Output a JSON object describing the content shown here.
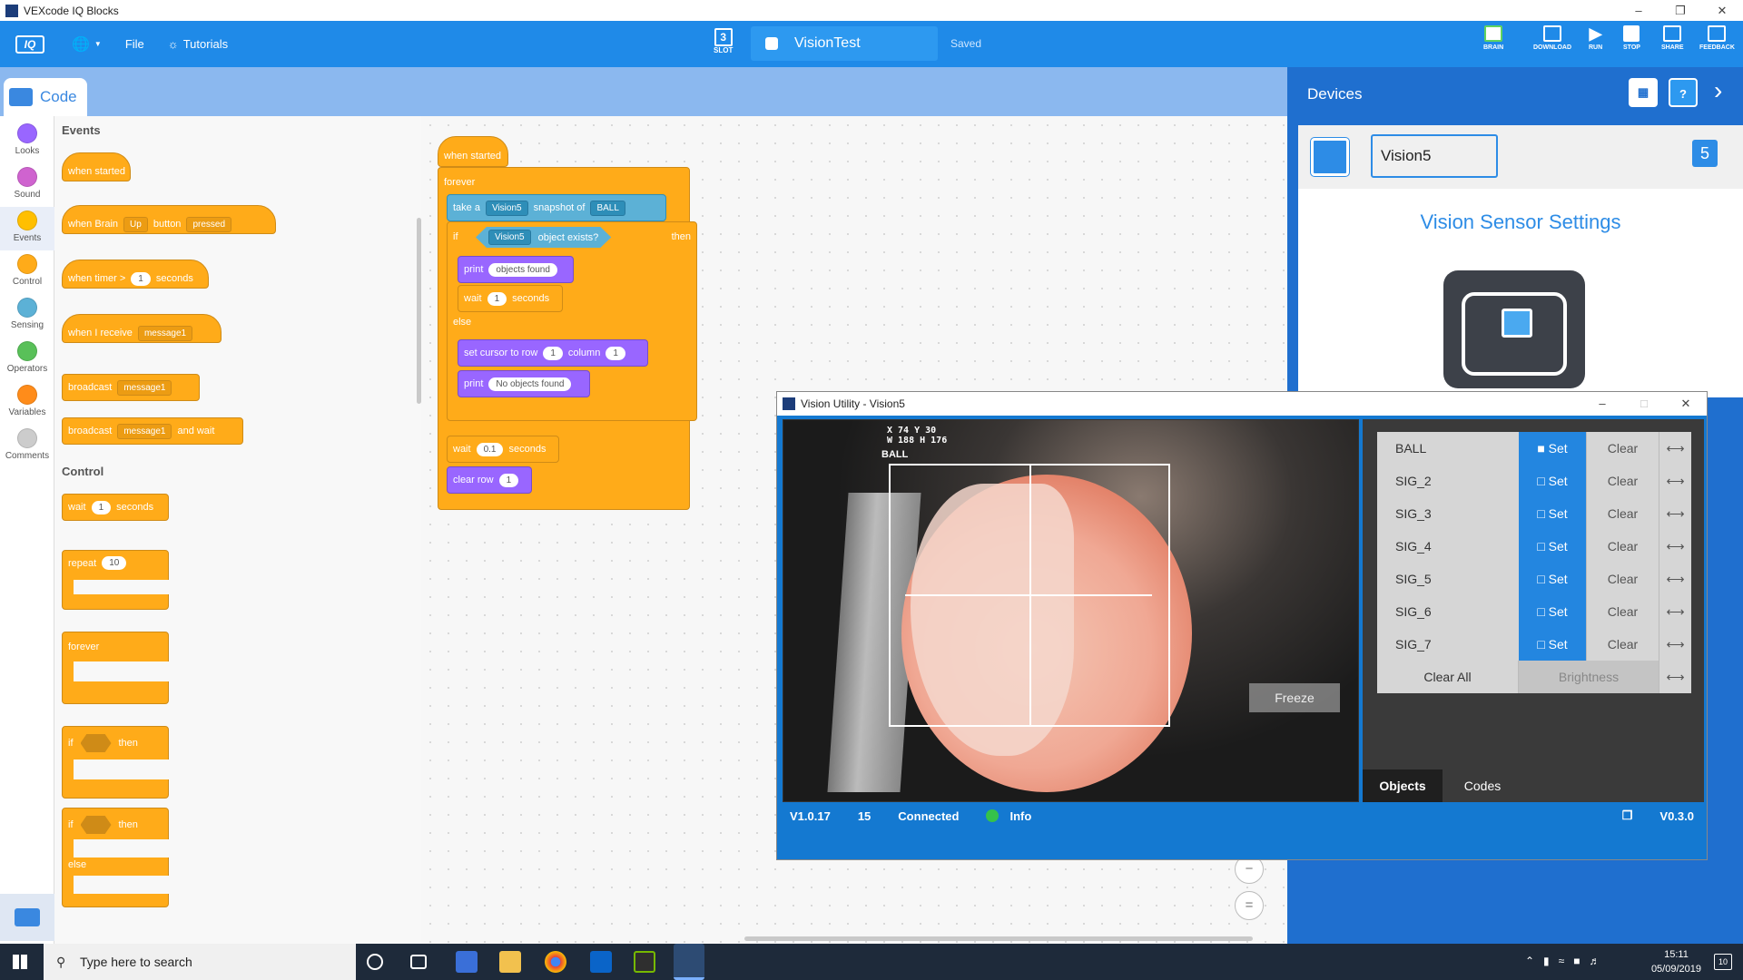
{
  "app_title": "VEXcode IQ Blocks",
  "toolbar": {
    "logo": "IQ",
    "file": "File",
    "tutorials": "Tutorials",
    "slot_num": "3",
    "slot_label": "SLOT",
    "project_name": "VisionTest",
    "saved": "Saved",
    "brain": "BRAIN",
    "download": "DOWNLOAD",
    "run": "RUN",
    "stop": "STOP",
    "share": "SHARE",
    "feedback": "FEEDBACK"
  },
  "code_tab": "Code",
  "categories": [
    "Looks",
    "Sound",
    "Events",
    "Control",
    "Sensing",
    "Operators",
    "Variables",
    "Comments"
  ],
  "category_colors": [
    "#9966ff",
    "#cf63cf",
    "#ffbf00",
    "#ffab19",
    "#5cb1d6",
    "#59c059",
    "#ff8c1a",
    "#cccccc"
  ],
  "flyout": {
    "events_heading": "Events",
    "control_heading": "Control",
    "when_started": "when started",
    "when_brain": "when Brain",
    "up": "Up",
    "button": "button",
    "pressed": "pressed",
    "when_timer": "when timer >",
    "timer_val": "1",
    "seconds": "seconds",
    "when_receive": "when I receive",
    "message1": "message1",
    "broadcast": "broadcast",
    "and_wait": "and wait",
    "wait": "wait",
    "wait_val": "1",
    "repeat": "repeat",
    "repeat_val": "10",
    "forever": "forever",
    "if": "if",
    "then": "then",
    "else": "else"
  },
  "script": {
    "when_started": "when started",
    "forever": "forever",
    "take_a": "take a",
    "vision5": "Vision5",
    "snapshot_of": "snapshot of",
    "ball": "BALL",
    "if": "if",
    "object_exists": "object exists?",
    "then": "then",
    "print": "print",
    "objects_found": "objects found",
    "wait": "wait",
    "one": "1",
    "seconds": "seconds",
    "else": "else",
    "set_cursor": "set cursor to row",
    "column": "column",
    "no_objects": "No objects found",
    "wait_val": "0.1",
    "clear_row": "clear row"
  },
  "devices": {
    "heading": "Devices",
    "name": "Vision5",
    "port": "5",
    "settings_title": "Vision Sensor Settings"
  },
  "vision_utility": {
    "title": "Vision Utility - Vision5",
    "overlay_line1": "X 74 Y 30",
    "overlay_line2": "W 188 H 176",
    "overlay_label": "BALL",
    "freeze": "Freeze",
    "signatures": [
      {
        "name": "BALL",
        "set": "Set",
        "clear": "Clear"
      },
      {
        "name": "SIG_2",
        "set": "Set",
        "clear": "Clear"
      },
      {
        "name": "SIG_3",
        "set": "Set",
        "clear": "Clear"
      },
      {
        "name": "SIG_4",
        "set": "Set",
        "clear": "Clear"
      },
      {
        "name": "SIG_5",
        "set": "Set",
        "clear": "Clear"
      },
      {
        "name": "SIG_6",
        "set": "Set",
        "clear": "Clear"
      },
      {
        "name": "SIG_7",
        "set": "Set",
        "clear": "Clear"
      }
    ],
    "clear_all": "Clear All",
    "brightness": "Brightness",
    "tab_objects": "Objects",
    "tab_codes": "Codes",
    "status": {
      "version": "V1.0.17",
      "fps": "15",
      "connected": "Connected",
      "info": "Info",
      "app_version": "V0.3.0"
    }
  },
  "taskbar": {
    "search_placeholder": "Type here to search",
    "time": "15:11",
    "date": "05/09/2019",
    "notif_count": "10"
  }
}
